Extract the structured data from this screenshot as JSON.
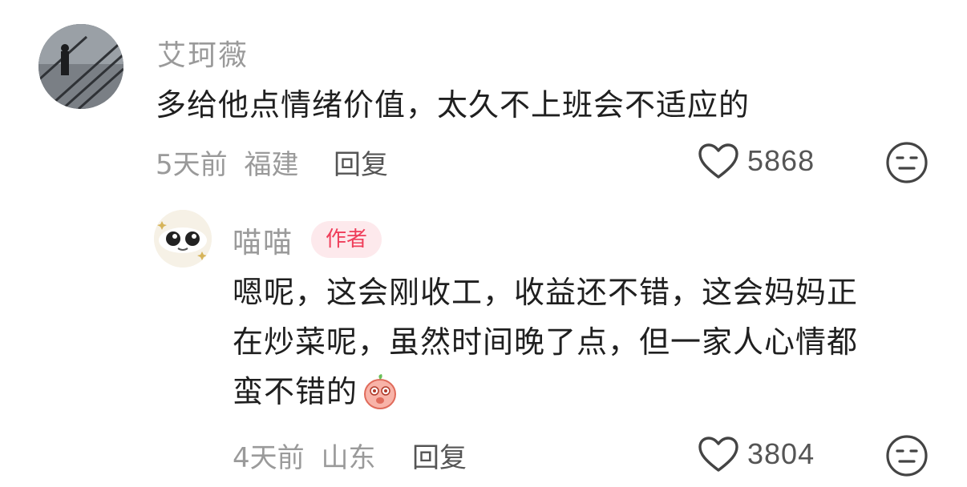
{
  "comments": [
    {
      "username": "艾珂薇",
      "text": "多给他点情绪价值，太久不上班会不适应的",
      "time": "5天前",
      "location": "福建",
      "reply_label": "回复",
      "likes": "5868"
    }
  ],
  "reply": {
    "username": "喵喵",
    "badge": "作者",
    "text_line1": "嗯呢，这会刚收工，收益还不错，这会妈妈正",
    "text_line2": "在炒菜呢，虽然时间晚了点，但一家人心情都",
    "text_line3": "蛮不错的",
    "time": "4天前",
    "location": "山东",
    "reply_label": "回复",
    "likes": "3804"
  },
  "colors": {
    "accent": "#ef3e5a",
    "badge_bg": "#fde9ec",
    "muted": "#9a9a9a"
  },
  "icons": [
    "heart-icon",
    "emoji-face-icon",
    "peach-emoji-icon"
  ]
}
